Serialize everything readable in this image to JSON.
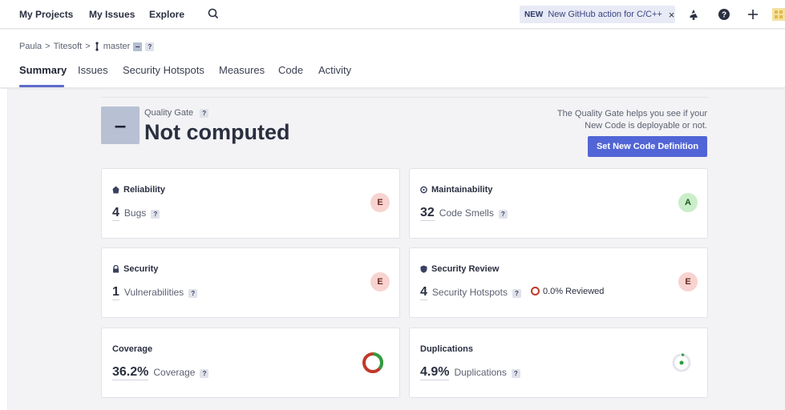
{
  "topnav": {
    "my_projects": "My Projects",
    "my_issues": "My Issues",
    "explore": "Explore",
    "search_icon": "search-icon",
    "news_badge": "NEW",
    "news_text": "New GitHub action for C/C++",
    "news_close": "×"
  },
  "breadcrumb": {
    "org": "Paula",
    "sep1": ">",
    "project": "Titesoft",
    "sep2": ">",
    "branch": "master",
    "branch_chip": "–",
    "help": "?"
  },
  "tabs": [
    {
      "label": "Summary",
      "active": true
    },
    {
      "label": "Issues"
    },
    {
      "label": "Security Hotspots"
    },
    {
      "label": "Measures"
    },
    {
      "label": "Code"
    },
    {
      "label": "Activity"
    }
  ],
  "quality_gate": {
    "symbol": "–",
    "label": "Quality Gate",
    "help": "?",
    "status": "Not computed",
    "help_text_line1": "The Quality Gate helps you see if your",
    "help_text_line2": "New Code is deployable or not.",
    "button": "Set New Code Definition"
  },
  "cards": {
    "reliability": {
      "title": "Reliability",
      "value": "4",
      "label": "Bugs",
      "grade": "E"
    },
    "maintainability": {
      "title": "Maintainability",
      "value": "32",
      "label": "Code Smells",
      "grade": "A"
    },
    "security": {
      "title": "Security",
      "value": "1",
      "label": "Vulnerabilities",
      "grade": "E"
    },
    "security_review": {
      "title": "Security Review",
      "value": "4",
      "label": "Security Hotspots",
      "reviewed": "0.0% Reviewed",
      "grade": "E"
    },
    "coverage": {
      "title": "Coverage",
      "value": "36.2%",
      "label": "Coverage",
      "coverage_fraction": 0.362
    },
    "duplications": {
      "title": "Duplications",
      "value": "4.9%",
      "label": "Duplications",
      "duplication_fraction": 0.049
    }
  },
  "colors": {
    "accent": "#5265d6",
    "grade_e_bg": "#f8d3cf",
    "grade_a_bg": "#c9eec9",
    "coverage_good": "#2e9e3e",
    "coverage_bad": "#c0392b"
  }
}
